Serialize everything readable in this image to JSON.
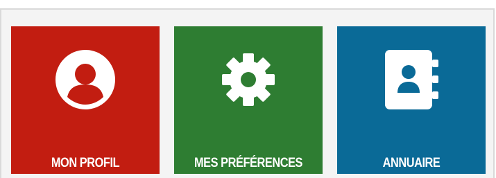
{
  "tiles": [
    {
      "id": "profile",
      "label": "MON PROFIL",
      "icon": "user-circle-icon",
      "color": "#c21d11"
    },
    {
      "id": "preferences",
      "label": "MES PRÉFÉRENCES",
      "icon": "gear-icon",
      "color": "#2e7d32"
    },
    {
      "id": "directory",
      "label": "ANNUAIRE",
      "icon": "address-book-icon",
      "color": "#0a6a97"
    }
  ],
  "colors": {
    "panel_background": "#f4f4f4",
    "panel_border": "#d9d9d9",
    "text": "#ffffff"
  }
}
